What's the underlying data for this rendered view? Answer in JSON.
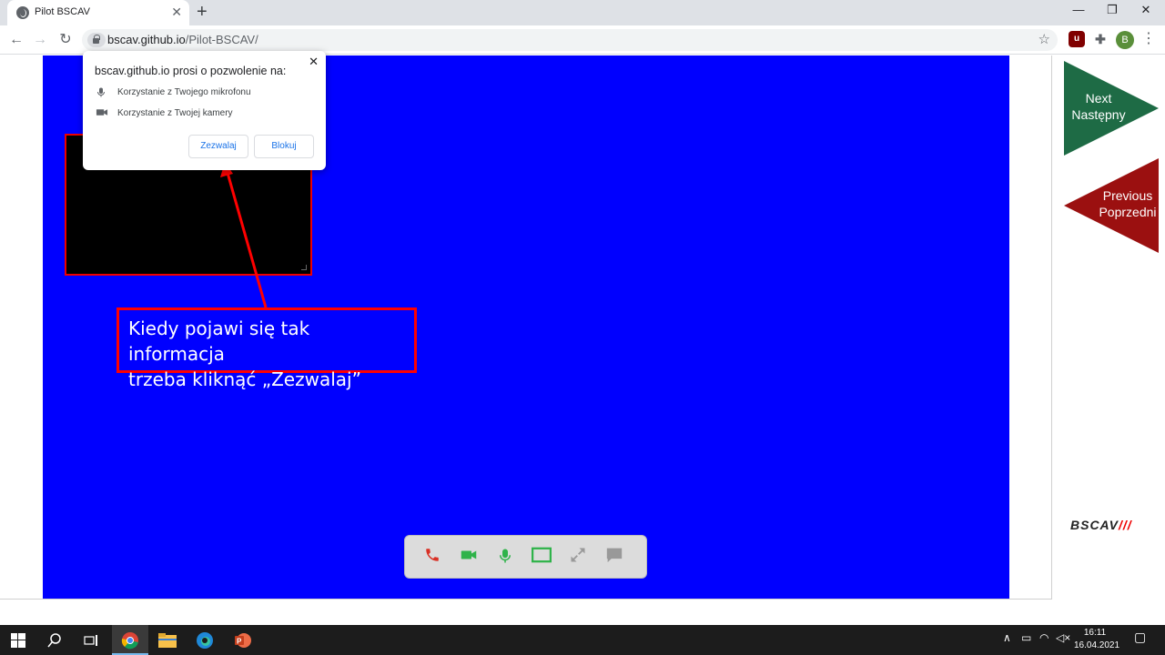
{
  "browser": {
    "tab_title": "Pilot BSCAV",
    "url_host": "bscav.github.io",
    "url_path": "/Pilot-BSCAV/",
    "profile_initial": "B"
  },
  "permission_popup": {
    "title": "bscav.github.io prosi o pozwolenie na:",
    "permissions": [
      {
        "icon": "microphone-icon",
        "label": "Korzystanie z Twojego mikrofonu"
      },
      {
        "icon": "camera-icon",
        "label": "Korzystanie z Twojej kamery"
      }
    ],
    "allow_label": "Zezwalaj",
    "block_label": "Blokuj"
  },
  "annotation": {
    "line1": "Kiedy pojawi się tak informacja",
    "line2": "trzeba kliknąć „Zezwalaj”"
  },
  "side_nav": {
    "next_en": "Next",
    "next_pl": "Następny",
    "prev_en": "Previous",
    "prev_pl": "Poprzedni",
    "next_color": "#1e6b45",
    "prev_color": "#9b1010"
  },
  "logo": {
    "text": "BSCAV",
    "mark": "///"
  },
  "call_controls": [
    {
      "name": "hangup-icon",
      "color": "#d93025"
    },
    {
      "name": "video-camera-icon",
      "color": "#2fb34a"
    },
    {
      "name": "microphone-icon",
      "color": "#2fb34a"
    },
    {
      "name": "screen-share-icon",
      "color": "#2fb34a"
    },
    {
      "name": "fullscreen-icon",
      "color": "#999999"
    },
    {
      "name": "chat-icon",
      "color": "#999999"
    }
  ],
  "stage_color": "#0000ff",
  "taskbar": {
    "time": "16:11",
    "date": "16.04.2021"
  }
}
